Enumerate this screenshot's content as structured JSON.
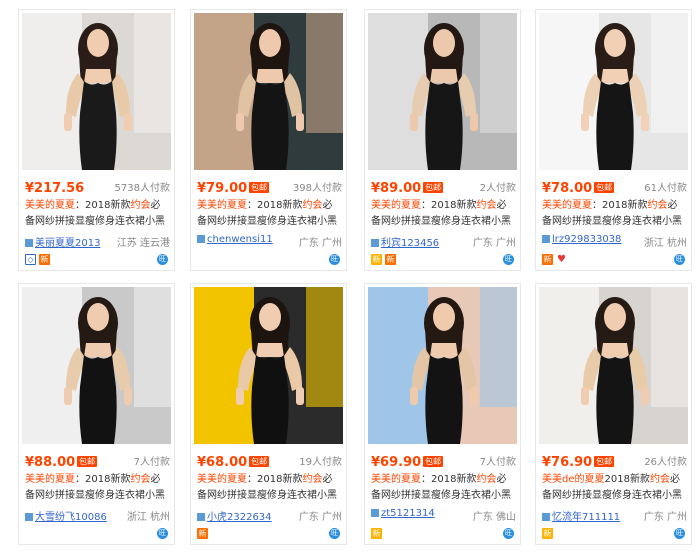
{
  "products": [
    {
      "price": "¥217.56",
      "baoyou": false,
      "sales": "5738人付款",
      "title_hl": "美美的夏夏",
      "title_a": "：2018新款",
      "title_hl2": "约会",
      "title_b": "必备网纱拼接显瘦修身连衣裙小黑裙",
      "seller": "美丽夏夏2013",
      "location": "江苏 连云港",
      "badges": [
        "tmall",
        "xin"
      ],
      "colors": {
        "bg1": "#dcd8d4",
        "bg2": "#f0eeec",
        "dress": "#1a1a1a",
        "sleeve": "#e8c9a8",
        "skin": "#f0cdb0",
        "hair": "#2a1c16"
      }
    },
    {
      "price": "¥79.00",
      "baoyou": true,
      "sales": "398人付款",
      "title_hl": "美美的夏夏",
      "title_a": "：2018新款",
      "title_hl2": "约会",
      "title_b": "必备网纱拼接显瘦修身连衣裙小黑裙",
      "seller": "chenwensi11",
      "location": "广东 广州",
      "badges": [],
      "colors": {
        "bg1": "#2f3b3c",
        "bg2": "#c4a489",
        "dress": "#141414",
        "sleeve": "#e0c3a2",
        "skin": "#eec9ad",
        "hair": "#1e1511"
      }
    },
    {
      "price": "¥89.00",
      "baoyou": true,
      "sales": "2人付款",
      "title_hl": "美美的夏夏",
      "title_a": "：2018新款",
      "title_hl2": "约会",
      "title_b": "必备网纱拼接显瘦修身连衣裙小黑裙",
      "seller": "利宾123456",
      "location": "广东 广州",
      "badges": [
        "gold",
        "xin"
      ],
      "colors": {
        "bg1": "#b8b8b8",
        "bg2": "#dedede",
        "dress": "#161616",
        "sleeve": "#e6cdb2",
        "skin": "#ecc9ad",
        "hair": "#231813"
      }
    },
    {
      "price": "¥78.00",
      "baoyou": true,
      "sales": "61人付款",
      "title_hl": "美美的夏夏",
      "title_a": "：2018新款",
      "title_hl2": "约会",
      "title_b": "必备网纱拼接显瘦修身连衣裙小黑裙",
      "seller": "lrz929833038",
      "location": "浙江 杭州",
      "badges": [
        "xin",
        "heart"
      ],
      "colors": {
        "bg1": "#e6e6e6",
        "bg2": "#f6f6f6",
        "dress": "#151515",
        "sleeve": "#ecd1b6",
        "skin": "#f1d0b6",
        "hair": "#2a1d17"
      }
    },
    {
      "price": "¥88.00",
      "baoyou": true,
      "sales": "7人付款",
      "title_hl": "美美的夏夏",
      "title_a": "：2018新款",
      "title_hl2": "约会",
      "title_b": "必备网纱拼接显瘦修身连衣裙小黑裙",
      "seller": "大雪纷飞10086",
      "location": "浙江 杭州",
      "badges": [],
      "colors": {
        "bg1": "#c9c9c9",
        "bg2": "#efefef",
        "dress": "#121212",
        "sleeve": "#e7cbaa",
        "skin": "#efcbb0",
        "hair": "#241913"
      }
    },
    {
      "price": "¥68.00",
      "baoyou": true,
      "sales": "19人付款",
      "title_hl": "美美的夏夏",
      "title_a": "：2018新款",
      "title_hl2": "约会",
      "title_b": "必备网纱拼接显瘦修身连衣裙小黑裙",
      "seller": "小虎2322634",
      "location": "广东 广州",
      "badges": [
        "xin"
      ],
      "colors": {
        "bg1": "#2b2b2b",
        "bg2": "#f2c400",
        "dress": "#101010",
        "sleeve": "#e9c9a6",
        "skin": "#f0ccb0",
        "hair": "#1d1410"
      }
    },
    {
      "price": "¥69.90",
      "baoyou": true,
      "sales": "7人付款",
      "title_hl": "美美的夏夏",
      "title_a": "：2018新款",
      "title_hl2": "约会",
      "title_b": "必备网纱拼接显瘦修身连衣裙小黑裙",
      "seller": "zt5121314",
      "location": "广东 佛山",
      "badges": [
        "gold"
      ],
      "colors": {
        "bg1": "#e8c9b8",
        "bg2": "#9fc6e8",
        "dress": "#131313",
        "sleeve": "#e4c5a5",
        "skin": "#efcaad",
        "hair": "#241812"
      }
    },
    {
      "price": "¥76.90",
      "baoyou": true,
      "sales": "26人付款",
      "title_hl": "美美de的夏夏",
      "title_a": "2018新款",
      "title_hl2": "约会",
      "title_b": "必备网纱拼接显瘦修身连衣裙小黑裙",
      "seller": "忆流年711111",
      "location": "广东 广州",
      "badges": [
        "gold"
      ],
      "colors": {
        "bg1": "#d7d3cf",
        "bg2": "#f1efec",
        "dress": "#141414",
        "sleeve": "#e8cba9",
        "skin": "#f0ccb0",
        "hair": "#261a14"
      }
    }
  ],
  "labels": {
    "baoyou": "包邮",
    "badge_xin": "新",
    "badge_tmall": "◇",
    "badge_heart": "♥",
    "ww": "旺"
  }
}
